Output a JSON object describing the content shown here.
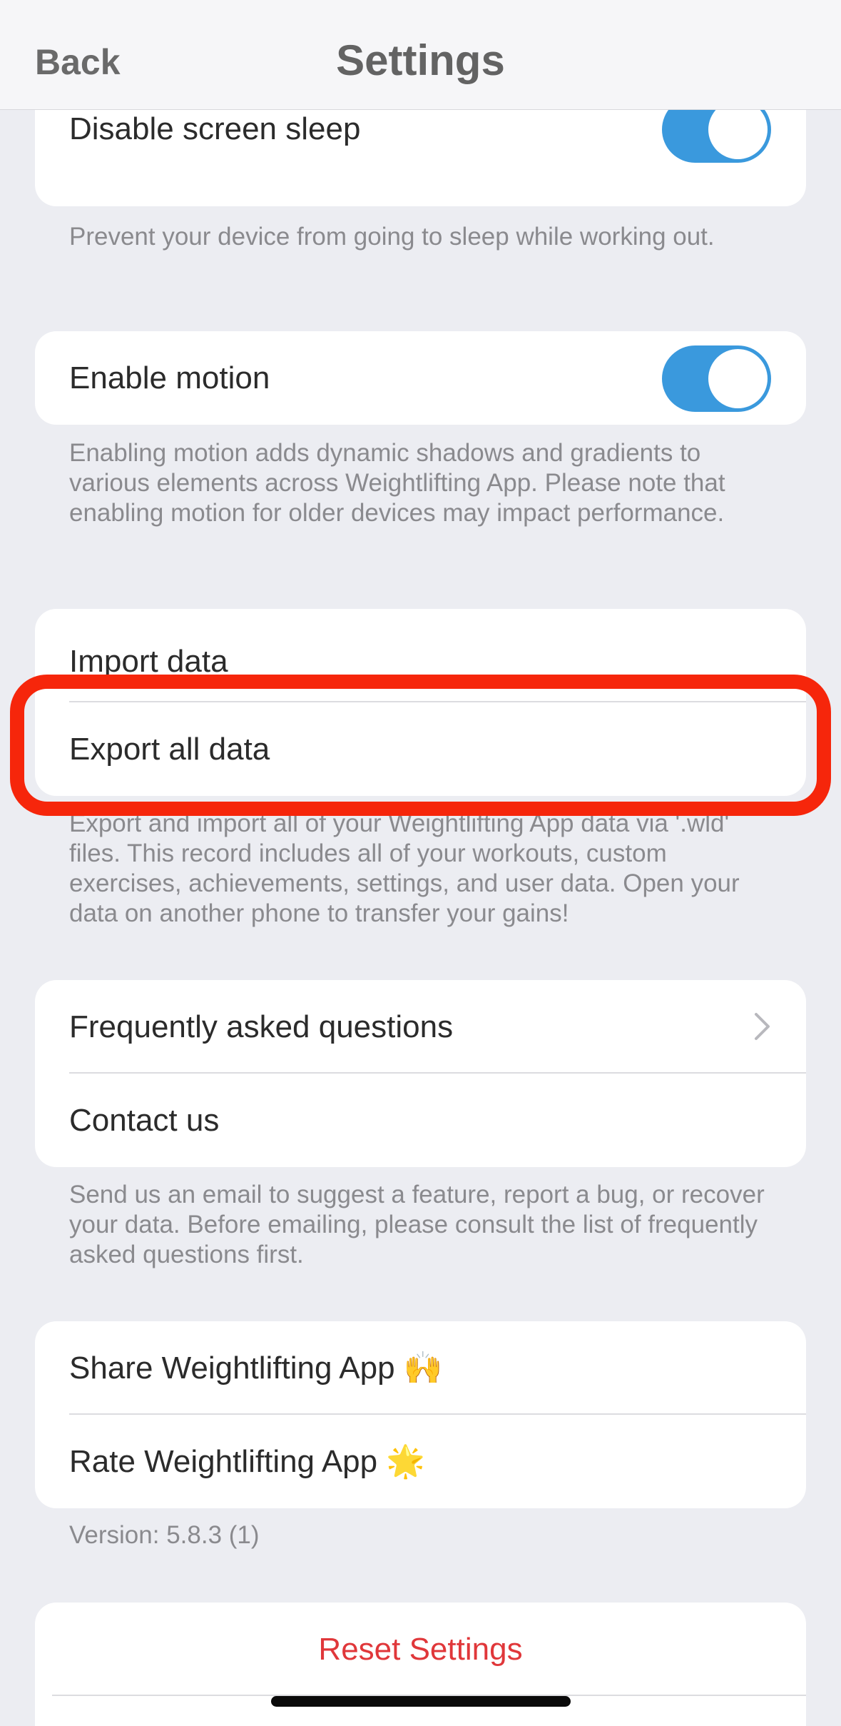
{
  "nav": {
    "back_label": "Back",
    "title": "Settings"
  },
  "display": {
    "disable_sleep": {
      "label": "Disable screen sleep",
      "enabled": true
    },
    "disable_sleep_note": "Prevent your device from going to sleep while working out.",
    "motion": {
      "label": "Enable motion",
      "enabled": true
    },
    "motion_note": "Enabling motion adds dynamic shadows and gradients to various elements across Weightlifting App. Please note that enabling motion for older devices may impact performance."
  },
  "data_section": {
    "import_label": "Import data",
    "export_label": "Export all data",
    "note": "Export and import all of your Weightlifting App data via '.wld' files. This record includes all of your workouts, custom exercises, achievements, settings, and user data. Open your data on another phone to transfer your gains!"
  },
  "support": {
    "faq_label": "Frequently asked questions",
    "contact_label": "Contact us",
    "note": "Send us an email to suggest a feature, report a bug, or recover your data. Before emailing, please consult the list of frequently asked questions first."
  },
  "share": {
    "share_label": "Share Weightlifting App",
    "share_emoji": "🙌",
    "rate_label": "Rate Weightlifting App",
    "rate_emoji": "🌟"
  },
  "version": "Version: 5.8.3 (1)",
  "reset_label": "Reset Settings",
  "colors": {
    "toggle_on": "#3a99dd",
    "highlight": "#f6260b",
    "destructive": "#e0373a"
  }
}
